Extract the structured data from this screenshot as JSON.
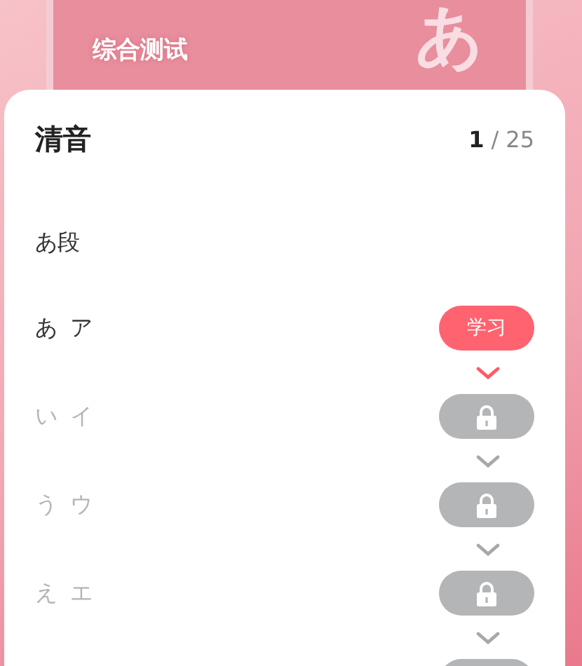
{
  "banner": {
    "title": "综合测试",
    "glyph": "あ"
  },
  "panel": {
    "title": "清音",
    "progress_current": "1",
    "progress_separator": "/",
    "progress_total": "25",
    "section": "あ段",
    "rows": [
      {
        "label": "あ ア",
        "locked": false,
        "button": "学习"
      },
      {
        "label": "い イ",
        "locked": true
      },
      {
        "label": "う ウ",
        "locked": true
      },
      {
        "label": "え エ",
        "locked": true
      },
      {
        "locked": true
      }
    ]
  }
}
